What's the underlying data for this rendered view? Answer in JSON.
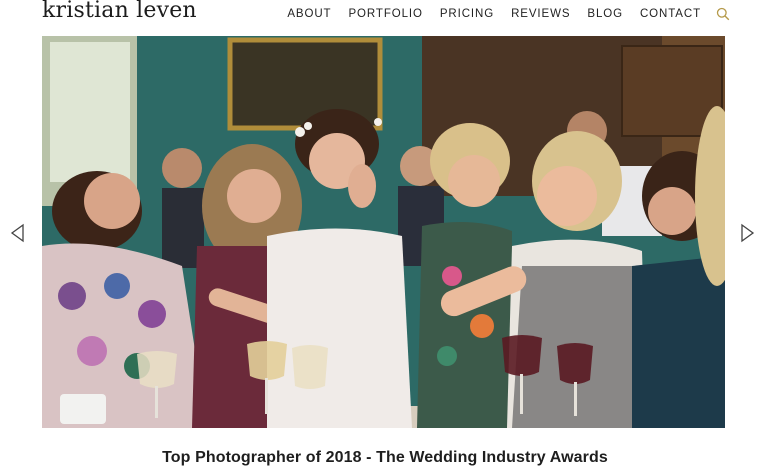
{
  "site": {
    "logo_text": "kristian leven"
  },
  "nav": {
    "items": [
      {
        "label": "ABOUT"
      },
      {
        "label": "PORTFOLIO"
      },
      {
        "label": "PRICING"
      },
      {
        "label": "REVIEWS"
      },
      {
        "label": "BLOG"
      },
      {
        "label": "CONTACT"
      }
    ],
    "search_icon": "search-icon",
    "search_icon_color": "#b59a4a"
  },
  "slider": {
    "prev_icon": "chevron-left-icon",
    "next_icon": "chevron-right-icon",
    "photo_description_icon": "wedding-photo"
  },
  "caption": {
    "text": "Top Photographer of 2018 - The Wedding Industry Awards"
  },
  "colors": {
    "text": "#222222",
    "accent": "#b59a4a"
  }
}
